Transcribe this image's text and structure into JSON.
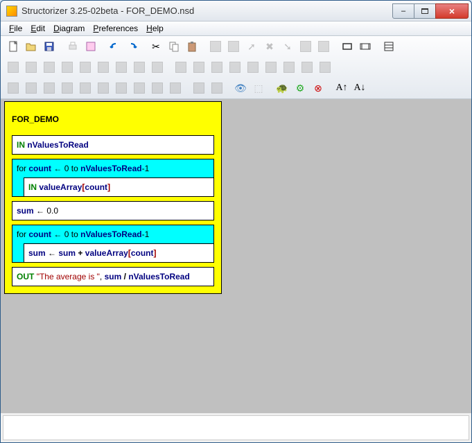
{
  "window": {
    "title": "Structorizer 3.25-02beta - FOR_DEMO.nsd",
    "min_label": "–",
    "max_label": "",
    "close_label": "×"
  },
  "menu": {
    "file": "File",
    "edit": "Edit",
    "diagram": "Diagram",
    "preferences": "Preferences",
    "help": "Help"
  },
  "diagram": {
    "title": "FOR_DEMO",
    "in_kw": "IN",
    "out_kw": "OUT",
    "for_kw": "for",
    "to_kw": "to",
    "nValuesToRead": "nValuesToRead",
    "count": "count",
    "valueArray": "valueArray",
    "sum": "sum",
    "zero": "0",
    "minus1": "-1",
    "zerof": "0.0",
    "arrow": "←",
    "plus": "+",
    "slash": "/",
    "lbr": "[",
    "rbr": "]",
    "out_str": "\"The average is \"",
    "comma": ","
  }
}
